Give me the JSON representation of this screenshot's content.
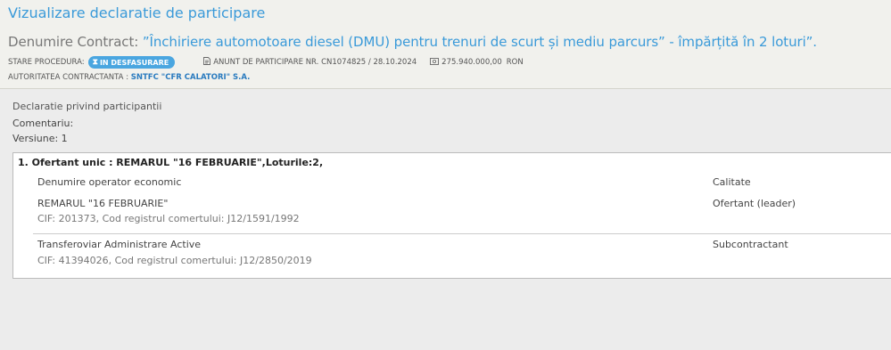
{
  "header": {
    "title": "Vizualizare declaratie de participare",
    "contract_label": "Denumire Contract:",
    "contract_name": "”Închiriere automotoare diesel (DMU) pentru trenuri de scurt și mediu parcurs” - împărțită în 2 loturi”.",
    "status_label": "STARE PROCEDURA:",
    "status_value": "IN DESFASURARE",
    "notice": "ANUNT DE PARTICIPARE NR. CN1074825 / 28.10.2024",
    "value": "275.940.000,00",
    "currency": "RON",
    "authority_label": "AUTORITATEA CONTRACTANTA :",
    "authority_value": "SNTFC \"CFR CALATORI\" S.A."
  },
  "declaration": {
    "section_title": "Declaratie privind participantii",
    "comment_label": "Comentariu:",
    "version_label": "Versiune: 1"
  },
  "offer": {
    "title": "1. Ofertant unic : REMARUL \"16 FEBRUARIE\",Loturile:2,",
    "col_operator": "Denumire operator economic",
    "col_role": "Calitate",
    "rows": [
      {
        "name": "REMARUL \"16 FEBRUARIE\"",
        "details": "CIF: 201373, Cod registrul comertului: J12/1591/1992",
        "role": "Ofertant (leader)"
      },
      {
        "name": "Transferoviar Administrare Active",
        "details": "CIF: 41394026, Cod registrul comertului: J12/2850/2019",
        "role": "Subcontractant"
      }
    ]
  },
  "colors": {
    "accent": "#3a9ad9",
    "badge": "#4aa6e0",
    "link": "#2a7bbf"
  },
  "icons": [
    "hourglass-icon",
    "document-icon",
    "money-icon"
  ]
}
